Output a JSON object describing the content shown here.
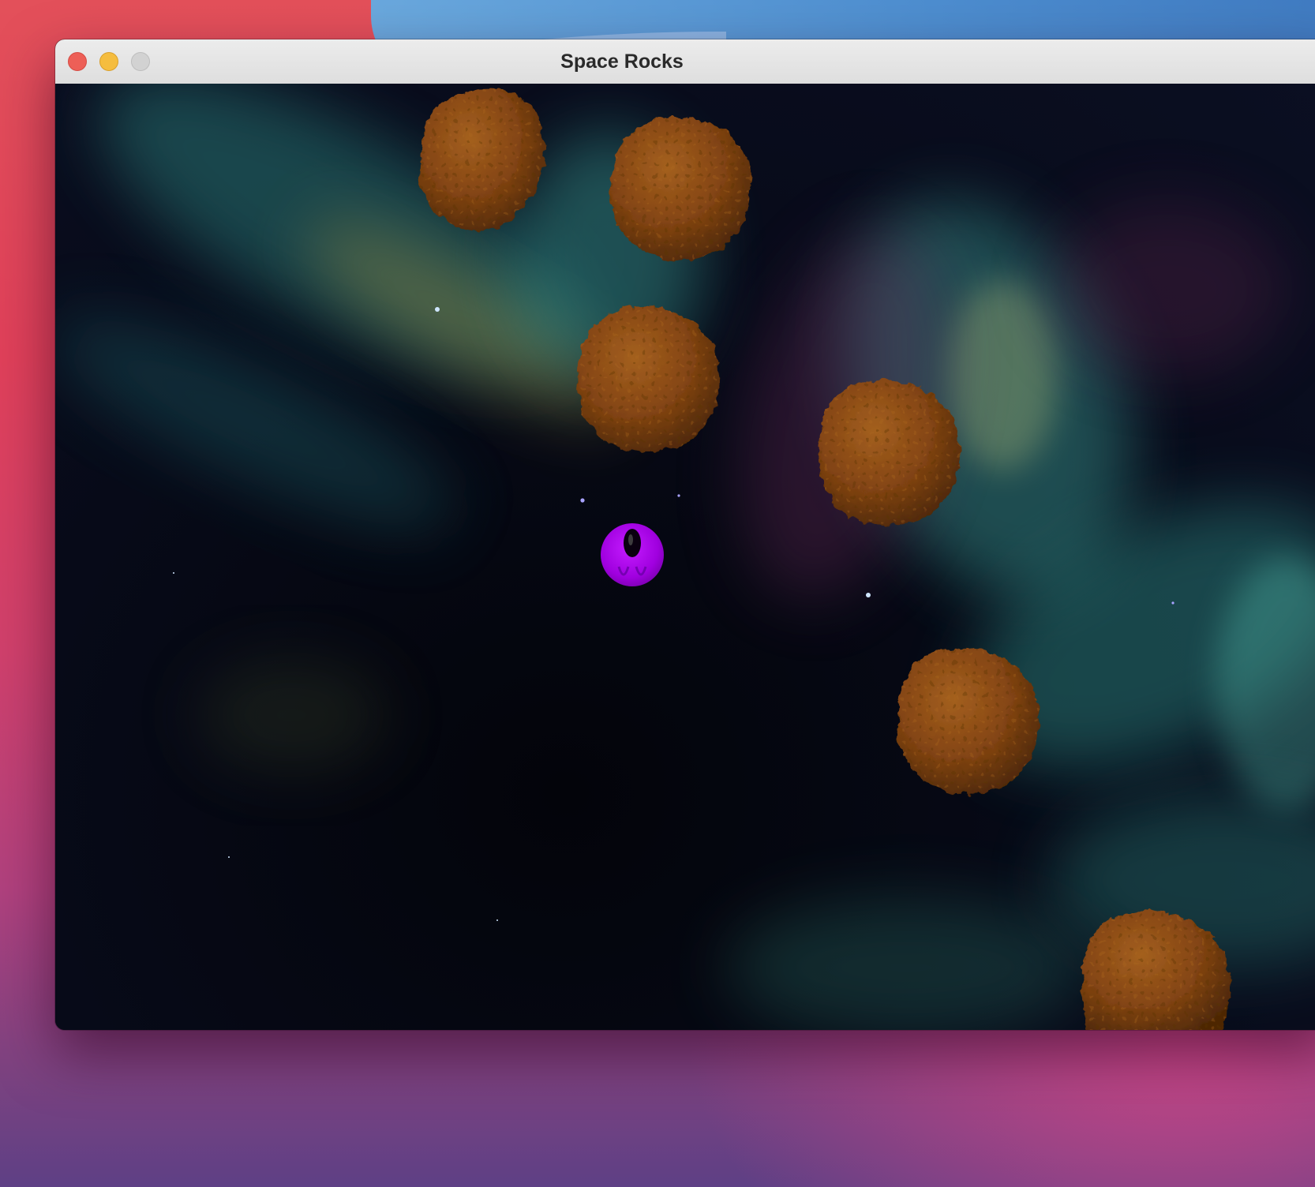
{
  "window": {
    "title": "Space Rocks"
  },
  "game": {
    "colors": {
      "space_background": "#05060f",
      "nebula_teal": "#3fa39a",
      "nebula_gold": "#b9a24a",
      "nebula_magenta": "#6a2a5a",
      "asteroid": "#8a4a14",
      "ship": "#a400e0"
    },
    "asteroid_count": 6,
    "player_ship": {
      "shape": "purple-sphere-ship"
    }
  }
}
